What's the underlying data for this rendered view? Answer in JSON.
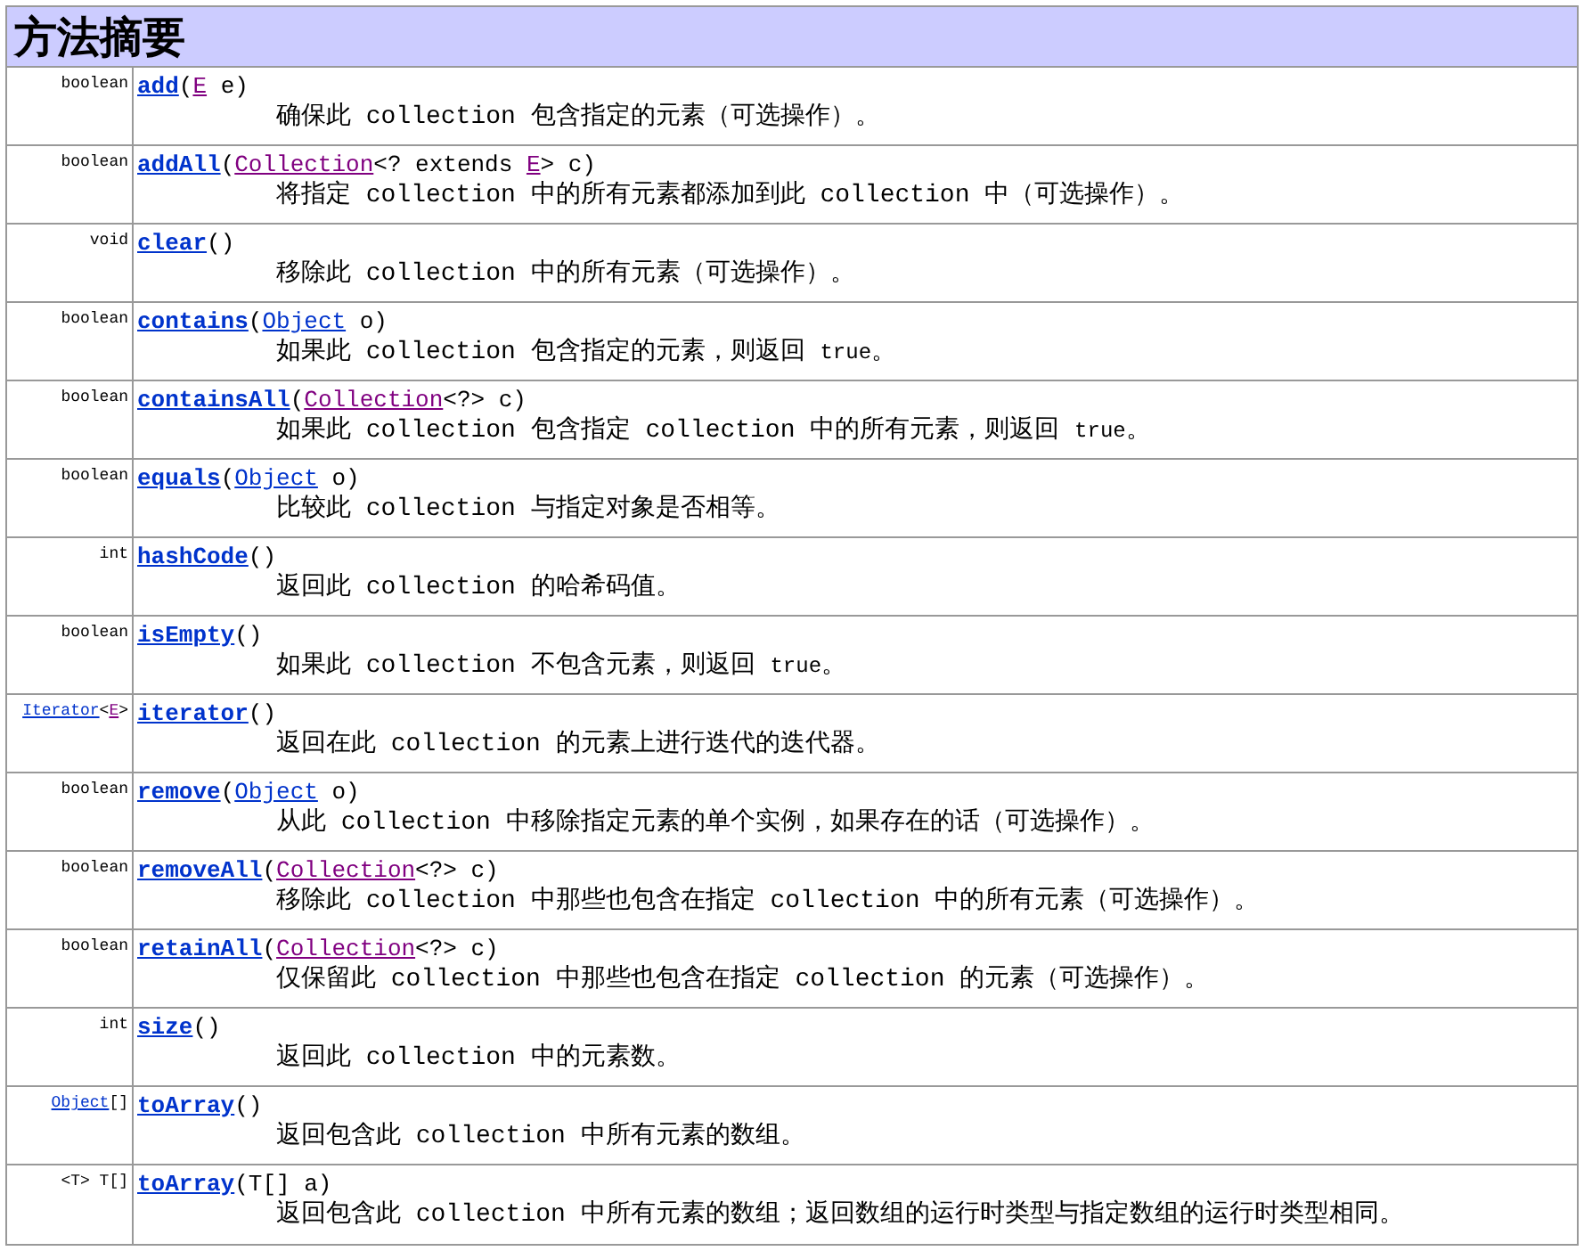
{
  "title": "方法摘要",
  "methods": [
    {
      "returns": [
        {
          "kind": "text",
          "text": "boolean"
        }
      ],
      "signature": [
        {
          "kind": "name",
          "text": "add"
        },
        {
          "kind": "text",
          "text": "("
        },
        {
          "kind": "visited",
          "text": "E"
        },
        {
          "kind": "text",
          "text": " e)"
        }
      ],
      "description": [
        {
          "kind": "text",
          "text": "确保此 collection 包含指定的元素（可选操作）。"
        }
      ]
    },
    {
      "returns": [
        {
          "kind": "text",
          "text": "boolean"
        }
      ],
      "signature": [
        {
          "kind": "name",
          "text": "addAll"
        },
        {
          "kind": "text",
          "text": "("
        },
        {
          "kind": "visited",
          "text": "Collection"
        },
        {
          "kind": "text",
          "text": "<? extends "
        },
        {
          "kind": "visited",
          "text": "E"
        },
        {
          "kind": "text",
          "text": "> c)"
        }
      ],
      "description": [
        {
          "kind": "text",
          "text": "将指定 collection 中的所有元素都添加到此 collection 中（可选操作）。"
        }
      ]
    },
    {
      "returns": [
        {
          "kind": "text",
          "text": "void"
        }
      ],
      "signature": [
        {
          "kind": "name",
          "text": "clear"
        },
        {
          "kind": "text",
          "text": "()"
        }
      ],
      "description": [
        {
          "kind": "text",
          "text": "移除此 collection 中的所有元素（可选操作）。"
        }
      ]
    },
    {
      "returns": [
        {
          "kind": "text",
          "text": "boolean"
        }
      ],
      "signature": [
        {
          "kind": "name",
          "text": "contains"
        },
        {
          "kind": "text",
          "text": "("
        },
        {
          "kind": "link",
          "text": "Object"
        },
        {
          "kind": "text",
          "text": " o)"
        }
      ],
      "description": [
        {
          "kind": "text",
          "text": "如果此 collection 包含指定的元素，则返回 "
        },
        {
          "kind": "code",
          "text": "true"
        },
        {
          "kind": "text",
          "text": "。"
        }
      ]
    },
    {
      "returns": [
        {
          "kind": "text",
          "text": "boolean"
        }
      ],
      "signature": [
        {
          "kind": "name",
          "text": "containsAll"
        },
        {
          "kind": "text",
          "text": "("
        },
        {
          "kind": "visited",
          "text": "Collection"
        },
        {
          "kind": "text",
          "text": "<?> c)"
        }
      ],
      "description": [
        {
          "kind": "text",
          "text": "如果此 collection 包含指定 collection 中的所有元素，则返回 "
        },
        {
          "kind": "code",
          "text": "true"
        },
        {
          "kind": "text",
          "text": "。"
        }
      ]
    },
    {
      "returns": [
        {
          "kind": "text",
          "text": "boolean"
        }
      ],
      "signature": [
        {
          "kind": "name",
          "text": "equals"
        },
        {
          "kind": "text",
          "text": "("
        },
        {
          "kind": "link",
          "text": "Object"
        },
        {
          "kind": "text",
          "text": " o)"
        }
      ],
      "description": [
        {
          "kind": "text",
          "text": "比较此 collection 与指定对象是否相等。"
        }
      ]
    },
    {
      "returns": [
        {
          "kind": "text",
          "text": "int"
        }
      ],
      "signature": [
        {
          "kind": "name",
          "text": "hashCode"
        },
        {
          "kind": "text",
          "text": "()"
        }
      ],
      "description": [
        {
          "kind": "text",
          "text": "返回此 collection 的哈希码值。"
        }
      ]
    },
    {
      "returns": [
        {
          "kind": "text",
          "text": "boolean"
        }
      ],
      "signature": [
        {
          "kind": "name",
          "text": "isEmpty"
        },
        {
          "kind": "text",
          "text": "()"
        }
      ],
      "description": [
        {
          "kind": "text",
          "text": "如果此 collection 不包含元素，则返回 "
        },
        {
          "kind": "code",
          "text": "true"
        },
        {
          "kind": "text",
          "text": "。"
        }
      ]
    },
    {
      "returns": [
        {
          "kind": "link",
          "text": "Iterator"
        },
        {
          "kind": "text",
          "text": "<"
        },
        {
          "kind": "visited",
          "text": "E"
        },
        {
          "kind": "text",
          "text": ">"
        }
      ],
      "signature": [
        {
          "kind": "name",
          "text": "iterator"
        },
        {
          "kind": "text",
          "text": "()"
        }
      ],
      "description": [
        {
          "kind": "text",
          "text": "返回在此 collection 的元素上进行迭代的迭代器。"
        }
      ]
    },
    {
      "returns": [
        {
          "kind": "text",
          "text": "boolean"
        }
      ],
      "signature": [
        {
          "kind": "name",
          "text": "remove"
        },
        {
          "kind": "text",
          "text": "("
        },
        {
          "kind": "link",
          "text": "Object"
        },
        {
          "kind": "text",
          "text": " o)"
        }
      ],
      "description": [
        {
          "kind": "text",
          "text": "从此 collection 中移除指定元素的单个实例，如果存在的话（可选操作）。"
        }
      ]
    },
    {
      "returns": [
        {
          "kind": "text",
          "text": "boolean"
        }
      ],
      "signature": [
        {
          "kind": "name",
          "text": "removeAll"
        },
        {
          "kind": "text",
          "text": "("
        },
        {
          "kind": "visited",
          "text": "Collection"
        },
        {
          "kind": "text",
          "text": "<?> c)"
        }
      ],
      "description": [
        {
          "kind": "text",
          "text": "移除此 collection 中那些也包含在指定 collection 中的所有元素（可选操作）。"
        }
      ]
    },
    {
      "returns": [
        {
          "kind": "text",
          "text": "boolean"
        }
      ],
      "signature": [
        {
          "kind": "name",
          "text": "retainAll"
        },
        {
          "kind": "text",
          "text": "("
        },
        {
          "kind": "visited",
          "text": "Collection"
        },
        {
          "kind": "text",
          "text": "<?> c)"
        }
      ],
      "description": [
        {
          "kind": "text",
          "text": "仅保留此 collection 中那些也包含在指定 collection 的元素（可选操作）。"
        }
      ]
    },
    {
      "returns": [
        {
          "kind": "text",
          "text": "int"
        }
      ],
      "signature": [
        {
          "kind": "name",
          "text": "size"
        },
        {
          "kind": "text",
          "text": "()"
        }
      ],
      "description": [
        {
          "kind": "text",
          "text": "返回此 collection 中的元素数。"
        }
      ]
    },
    {
      "returns": [
        {
          "kind": "link",
          "text": "Object"
        },
        {
          "kind": "text",
          "text": "[]"
        }
      ],
      "signature": [
        {
          "kind": "name",
          "text": "toArray"
        },
        {
          "kind": "text",
          "text": "()"
        }
      ],
      "description": [
        {
          "kind": "text",
          "text": "返回包含此 collection 中所有元素的数组。"
        }
      ]
    },
    {
      "returns": [
        {
          "kind": "text",
          "text": "<T> T[]"
        }
      ],
      "signature": [
        {
          "kind": "name",
          "text": "toArray"
        },
        {
          "kind": "text",
          "text": "(T[] a)"
        }
      ],
      "description": [
        {
          "kind": "text",
          "text": "返回包含此 collection 中所有元素的数组；返回数组的运行时类型与指定数组的运行时类型相同。"
        }
      ]
    }
  ]
}
